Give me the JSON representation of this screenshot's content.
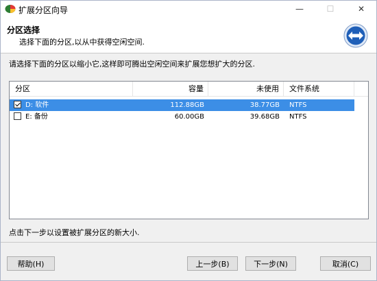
{
  "window": {
    "title": "扩展分区向导",
    "minimize": "—",
    "maximize": "☐",
    "close": "✕"
  },
  "header": {
    "title": "分区选择",
    "subtitle": "选择下面的分区,以从中获得空闲空间."
  },
  "instruction": "请选择下面的分区以缩小它,这样即可腾出空闲空间来扩展您想扩大的分区.",
  "table": {
    "columns": [
      "分区",
      "容量",
      "未使用",
      "文件系统"
    ],
    "rows": [
      {
        "partition": "D: 软件",
        "capacity": "112.88GB",
        "unused": "38.77GB",
        "filesystem": "NTFS",
        "checked": true,
        "selected": true
      },
      {
        "partition": "E: 备份",
        "capacity": "60.00GB",
        "unused": "39.68GB",
        "filesystem": "NTFS",
        "checked": false,
        "selected": false
      }
    ]
  },
  "hint": "点击下一步以设置被扩展分区的新大小.",
  "buttons": {
    "help": "帮助(H)",
    "prev": "上一步(B)",
    "next": "下一步(N)",
    "cancel": "取消(C)"
  },
  "colors": {
    "selection": "#3c8ee6",
    "logo_blue": "#1f5fb8"
  },
  "icons": {
    "app": "partition-wizard-icon",
    "logo": "double-arrow-icon"
  }
}
